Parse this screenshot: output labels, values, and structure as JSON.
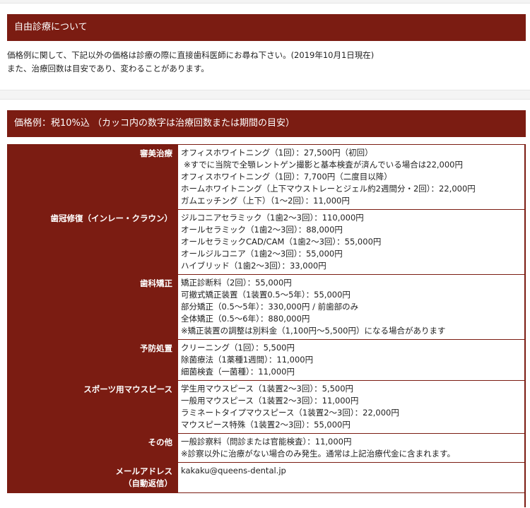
{
  "section1": {
    "title": "自由診療について",
    "notice_lines": [
      "価格例に関して、下記以外の価格は診療の際に直接歯科医師にお尋ね下さい。(2019年10月1日現在)",
      "また、治療回数は目安であり、変わることがあります。"
    ]
  },
  "section2": {
    "title": "価格例：税10%込 （カッコ内の数字は治療回数または期間の目安）"
  },
  "price_table": [
    {
      "category": "審美治療",
      "items": [
        "オフィスホワイトニング（1回）：27,500円（初回）",
        "※すでに当院で全顎レントゲン撮影と基本検査が済んでいる場合は22,000円",
        "オフィスホワイトニング（1回）：7,700円（二度目以降）",
        "ホームホワイトニング（上下マウストレーとジェル約2週間分・2回）：22,000円",
        "ガムエッチング（上下）（1～2回）：11,000円"
      ]
    },
    {
      "category": "歯冠修復（インレー・クラウン）",
      "items": [
        "ジルコニアセラミック（1歯2～3回）：110,000円",
        "オールセラミック（1歯2～3回）：88,000円",
        "オールセラミックCAD/CAM（1歯2～3回）：55,000円",
        "オールジルコニア（1歯2～3回）：55,000円",
        "ハイブリッド（1歯2～3回）：33,000円"
      ]
    },
    {
      "category": "歯科矯正",
      "items": [
        "矯正診断料（2回）：55,000円",
        "可撤式矯正装置（1装置0.5～5年）：55,000円",
        "部分矯正（0.5～5年）：330,000円 / 前歯部のみ",
        "全体矯正（0.5～6年）：880,000円",
        "※矯正装置の調整は別料金（1,100円～5,500円）になる場合があります"
      ]
    },
    {
      "category": "予防処置",
      "items": [
        "クリーニング（1回）：5,500円",
        "除菌療法（1薬種1週間）：11,000円",
        "細菌検査（一菌種）：11,000円"
      ]
    },
    {
      "category": "スポーツ用マウスピース",
      "items": [
        "学生用マウスピース（1装置2～3回）：5,500円",
        "一般用マウスピース（1装置2～3回）：11,000円",
        "ラミネートタイプマウスピース（1装置2～3回）：22,000円",
        "マウスピース特殊（1装置2～3回）：55,000円"
      ]
    },
    {
      "category": "その他",
      "items": [
        "一般診察料（問診または官能検査）：11,000円",
        "※診察以外に治療がない場合のみ発生。通常は上記治療代金に含まれます。"
      ]
    },
    {
      "category": "メールアドレス",
      "category_sub": "（自動返信）",
      "items": [
        "kakaku@queens-dental.jp"
      ]
    }
  ]
}
